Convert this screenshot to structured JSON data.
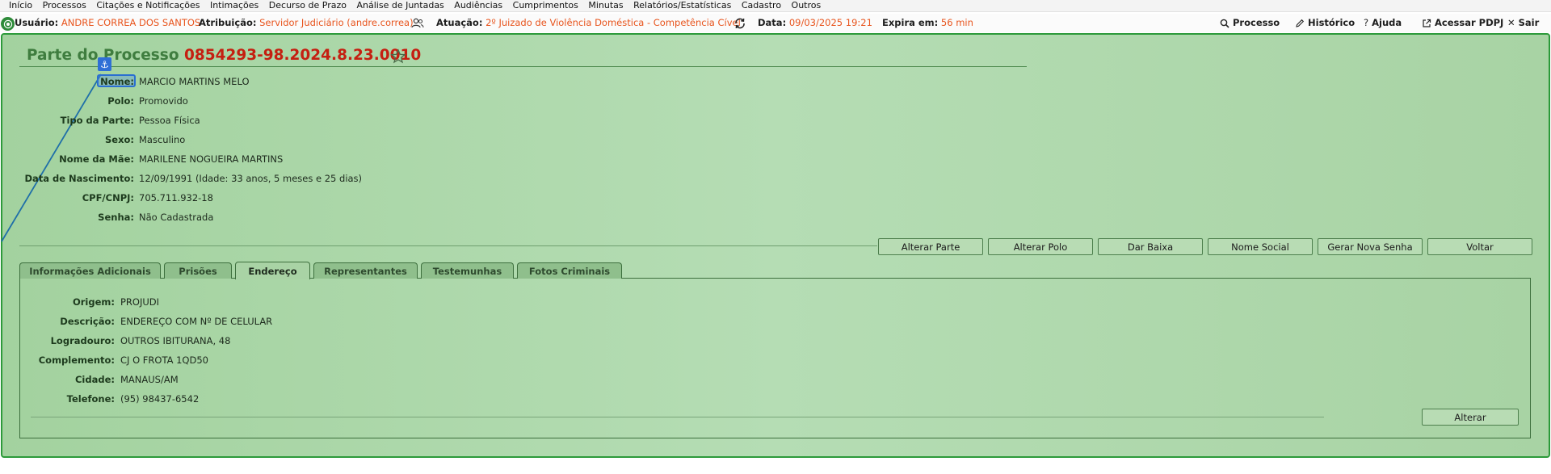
{
  "menu": [
    "Início",
    "Processos",
    "Citações e Notificações",
    "Intimações",
    "Decurso de Prazo",
    "Análise de Juntadas",
    "Audiências",
    "Cumprimentos",
    "Minutas",
    "Relatórios/Estatísticas",
    "Cadastro",
    "Outros"
  ],
  "info": {
    "usuario_label": "Usuário:",
    "usuario_value": "ANDRE CORREA DOS SANTOS",
    "atribuicao_label": "Atribuição:",
    "atribuicao_value": "Servidor Judiciário (andre.correa)",
    "atuacao_label": "Atuação:",
    "atuacao_value": "2º Juizado de Violência Doméstica - Competência Cível",
    "data_label": "Data:",
    "data_value": "09/03/2025 19:21",
    "expira_label": "Expira em:",
    "expira_value": "56 min"
  },
  "actions": {
    "processo": "Processo",
    "historico": "Histórico",
    "ajuda": "Ajuda",
    "acessar": "Acessar PDPJ",
    "sair": "Sair"
  },
  "page": {
    "title_prefix": "Parte do Processo",
    "process_number": "0854293-98.2024.8.23.0010"
  },
  "fields": [
    {
      "label": "Nome:",
      "value": "MARCIO MARTINS MELO"
    },
    {
      "label": "Polo:",
      "value": "Promovido"
    },
    {
      "label": "Tipo da Parte:",
      "value": "Pessoa Física"
    },
    {
      "label": "Sexo:",
      "value": "Masculino"
    },
    {
      "label": "Nome da Mãe:",
      "value": "MARILENE NOGUEIRA MARTINS"
    },
    {
      "label": "Data de Nascimento:",
      "value": "12/09/1991 (Idade: 33 anos, 5 meses e 25 dias)"
    },
    {
      "label": "CPF/CNPJ:",
      "value": "705.711.932-18"
    },
    {
      "label": "Senha:",
      "value": "Não Cadastrada"
    }
  ],
  "buttons": [
    "Alterar Parte",
    "Alterar Polo",
    "Dar Baixa",
    "Nome Social",
    "Gerar Nova Senha",
    "Voltar"
  ],
  "tabs": [
    "Informações Adicionais",
    "Prisões",
    "Endereço",
    "Representantes",
    "Testemunhas",
    "Fotos Criminais"
  ],
  "active_tab": "Endereço",
  "address": [
    {
      "label": "Origem:",
      "value": "PROJUDI"
    },
    {
      "label": "Descrição:",
      "value": "ENDEREÇO COM Nº DE CELULAR"
    },
    {
      "label": "Logradouro:",
      "value": "OUTROS IBITURANA, 48"
    },
    {
      "label": "Complemento:",
      "value": "CJ O FROTA 1QD50"
    },
    {
      "label": "Cidade:",
      "value": "MANAUS/AM"
    },
    {
      "label": "Telefone:",
      "value": "(95) 98437-6542"
    }
  ],
  "alterar_label": "Alterar",
  "colors": {
    "accent_orange": "#e8541d",
    "title_green": "#3f7d3f",
    "process_red": "#c51f11",
    "panel_green": "#b5ddb4"
  }
}
